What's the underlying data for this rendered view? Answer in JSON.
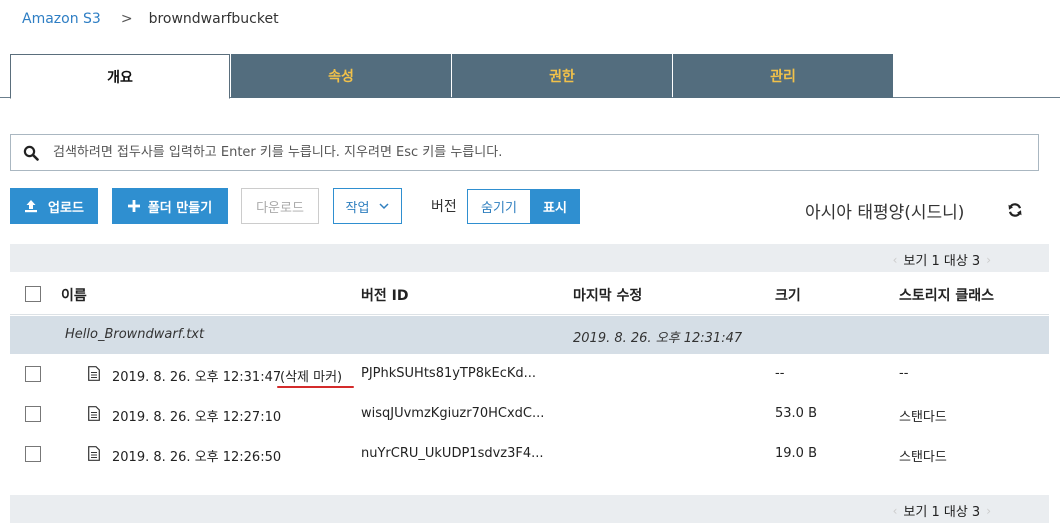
{
  "breadcrumb": {
    "root": "Amazon S3",
    "separator": ">",
    "current": "browndwarfbucket"
  },
  "tabs": [
    {
      "label": "개요",
      "active": true
    },
    {
      "label": "속성",
      "active": false
    },
    {
      "label": "권한",
      "active": false
    },
    {
      "label": "관리",
      "active": false
    }
  ],
  "search": {
    "placeholder": "검색하려면 접두사를 입력하고 Enter 키를 누릅니다. 지우려면 Esc 키를 누릅니다.",
    "value": "",
    "icon": "search-icon"
  },
  "toolbar": {
    "upload_label": "업로드",
    "new_folder_label": "폴더 만들기",
    "download_label": "다운로드",
    "actions_label": "작업",
    "version_label": "버전",
    "hide_label": "숨기기",
    "show_label": "표시",
    "region": "아시아 태평양(시드니)"
  },
  "pager": {
    "text": "보기 1 대상 3",
    "prev": "‹",
    "next": "›"
  },
  "table": {
    "headers": {
      "name": "이름",
      "version_id": "버전 ID",
      "last_modified": "마지막 수정",
      "size": "크기",
      "storage_class": "스토리지 클래스"
    },
    "group": {
      "name": "Hello_Browndwarf.txt",
      "last_modified": "2019. 8. 26. 오후 12:31:47"
    },
    "rows": [
      {
        "name": "2019. 8. 26. 오후 12:31:47",
        "marker": "(삭제 마커)",
        "version_id": "PJPhkSUHts81yTP8kEcKd...",
        "size": "--",
        "storage_class": "--"
      },
      {
        "name": "2019. 8. 26. 오후 12:27:10",
        "marker": "",
        "version_id": "wisqJUvmzKgiuzr70HCxdC...",
        "size": "53.0 B",
        "storage_class": "스탠다드"
      },
      {
        "name": "2019. 8. 26. 오후 12:26:50",
        "marker": "",
        "version_id": "nuYrCRU_UkUDP1sdvz3F4...",
        "size": "19.0 B",
        "storage_class": "스탠다드"
      }
    ]
  },
  "colors": {
    "accent": "#2f8fd0",
    "tab_bg": "#536d7e",
    "tab_text": "#f1c14a",
    "link": "#2e7ec4",
    "marker_underline": "#d42b2b"
  }
}
